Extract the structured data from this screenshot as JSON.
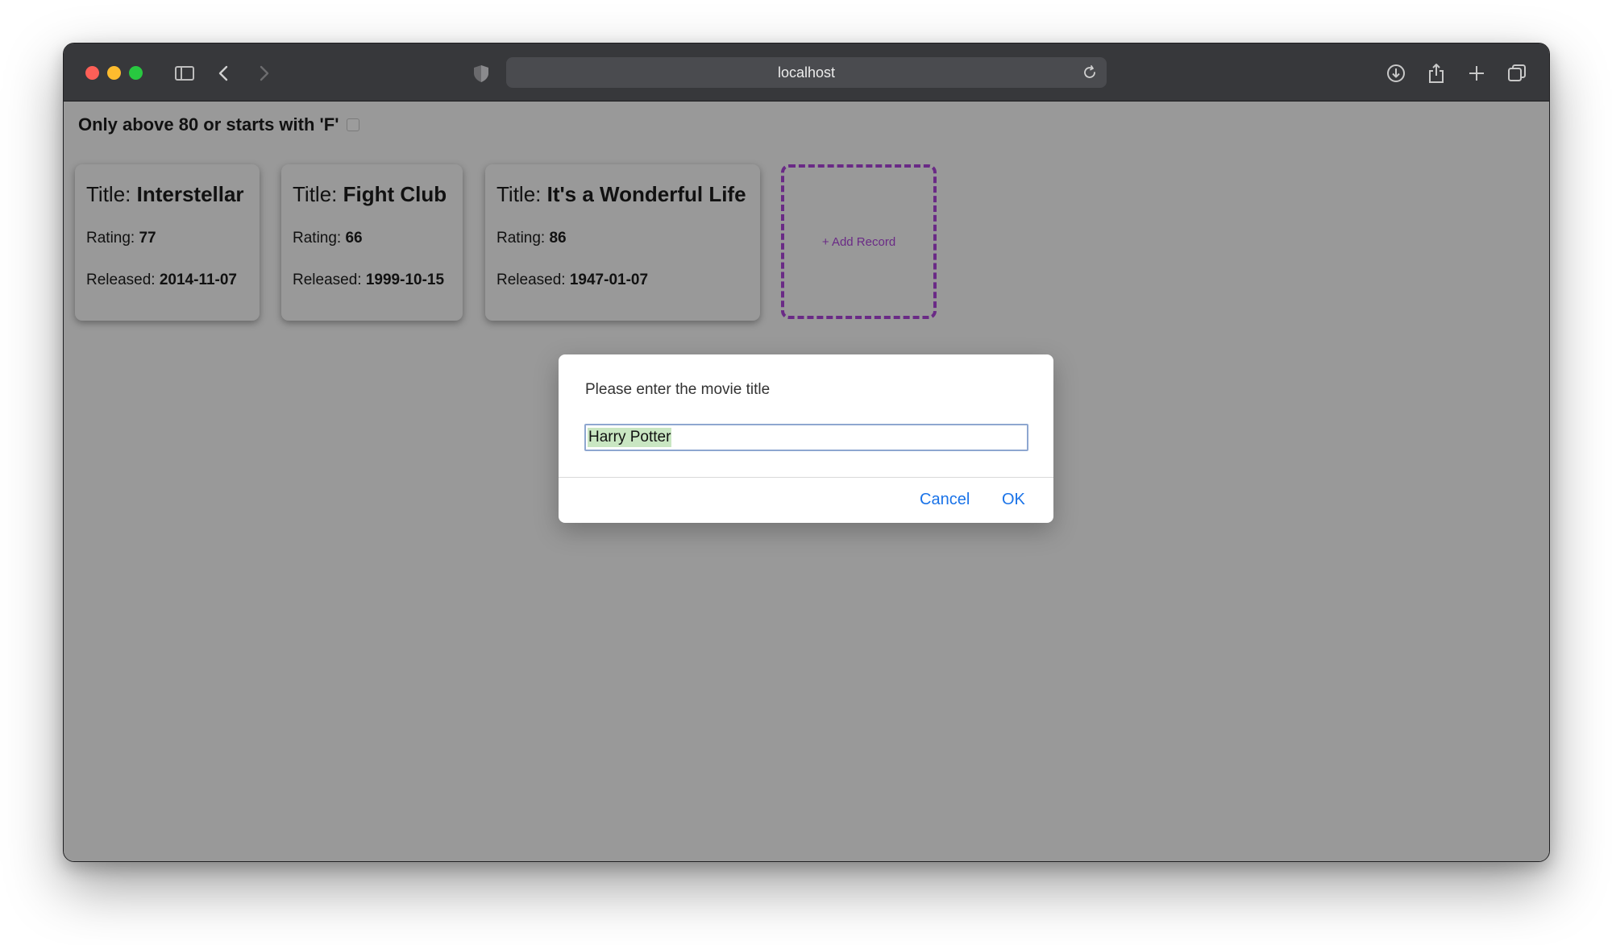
{
  "browser": {
    "url": "localhost"
  },
  "filter": {
    "label": "Only above 80 or starts with 'F'",
    "checked": false
  },
  "cards": [
    {
      "title_prefix": "Title: ",
      "title": "Interstellar",
      "rating_label": "Rating: ",
      "rating": "77",
      "released_label": "Released: ",
      "released": "2014-11-07"
    },
    {
      "title_prefix": "Title: ",
      "title": "Fight Club",
      "rating_label": "Rating: ",
      "rating": "66",
      "released_label": "Released: ",
      "released": "1999-10-15"
    },
    {
      "title_prefix": "Title: ",
      "title": "It's a Wonderful Life",
      "rating_label": "Rating: ",
      "rating": "86",
      "released_label": "Released: ",
      "released": "1947-01-07"
    }
  ],
  "add_record": {
    "label": "+ Add Record"
  },
  "dialog": {
    "message": "Please enter the movie title",
    "input_value": "Harry Potter",
    "cancel_label": "Cancel",
    "ok_label": "OK"
  }
}
